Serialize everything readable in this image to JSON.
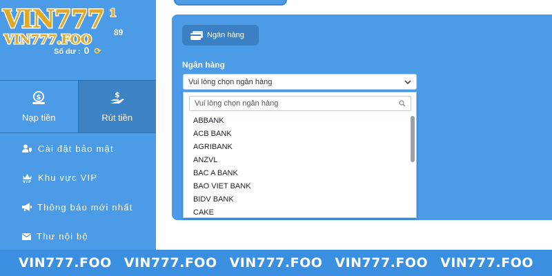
{
  "brand": {
    "logo_text": "VIN777",
    "logo_suffix": "1",
    "logo_domain": "VIN777.FOO"
  },
  "account": {
    "code": "89",
    "balance_label": "Số dư :",
    "balance_value": "0"
  },
  "actions": [
    {
      "label": "Nạp tiền",
      "icon": "deposit-dollar-icon"
    },
    {
      "label": "Rút tiền",
      "icon": "withdraw-hand-dollar-icon"
    }
  ],
  "menu": [
    {
      "label": "Cài đặt bảo mật",
      "icon": "user-shield-icon"
    },
    {
      "label": "Khu vực VIP",
      "icon": "vip-crown-icon"
    },
    {
      "label": "Thông báo mới nhất",
      "icon": "megaphone-icon"
    },
    {
      "label": "Thư nội bộ",
      "icon": "mail-icon"
    }
  ],
  "main": {
    "tab_label": "Ngân hàng",
    "field_label": "Ngân hàng",
    "select_value": "Vui lòng chọn ngân hàng",
    "search_placeholder": "Vui lòng chọn ngân hàng",
    "options": [
      "ABBANK",
      "ACB BANK",
      "AGRIBANK",
      "ANZVL",
      "BAC A BANK",
      "BAO VIET BANK",
      "BIDV BANK",
      "CAKE"
    ]
  },
  "banner": [
    "VIN777.FOO",
    "VIN777.FOO",
    "VIN777.FOO",
    "VIN777.FOO",
    "VIN777.FOO"
  ],
  "colors": {
    "panel": "#4b9be6",
    "tab": "#3b80c4",
    "banner": "#3a8fe0",
    "logo_gold": "#e0a824"
  }
}
